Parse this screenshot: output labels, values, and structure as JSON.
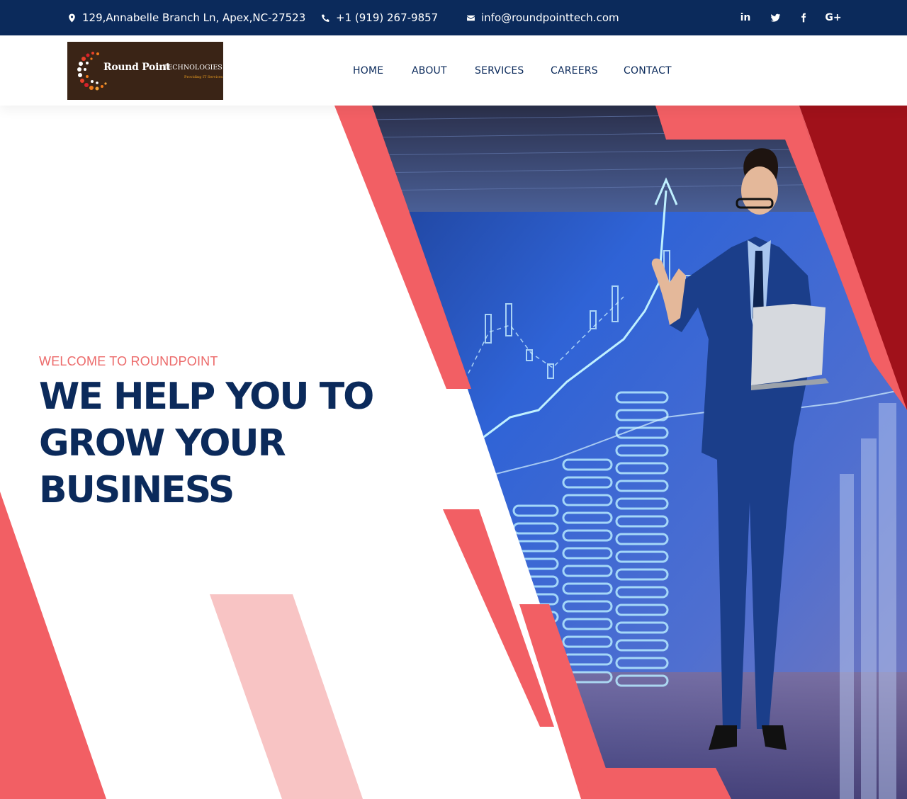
{
  "topbar": {
    "address": "129,Annabelle Branch Ln, Apex,NC-27523",
    "phone": "+1 (919) 267-9857",
    "email": "info@roundpointtech.com",
    "social": [
      "in",
      "t",
      "f",
      "G+"
    ]
  },
  "logo": {
    "brand": "Round Point",
    "brand_sub": "TECHNOLOGIES",
    "tagline": "Providing IT Services"
  },
  "nav": {
    "items": [
      "HOME",
      "ABOUT",
      "SERVICES",
      "CAREERS",
      "CONTACT"
    ]
  },
  "hero": {
    "welcome": "WELCOME TO ROUNDPOINT",
    "headline": [
      "WE HELP YOU TO",
      "GROW YOUR",
      "BUSINESS"
    ]
  },
  "colors": {
    "navy": "#0b2a5b",
    "coral": "#f25f64",
    "light_pink": "#f8c4c4",
    "dark_red": "#a0111a",
    "accent_text": "#ec6a6a"
  },
  "icons": [
    "map-marker-icon",
    "phone-icon",
    "envelope-icon",
    "linkedin-icon",
    "twitter-icon",
    "facebook-icon",
    "google-plus-icon"
  ]
}
